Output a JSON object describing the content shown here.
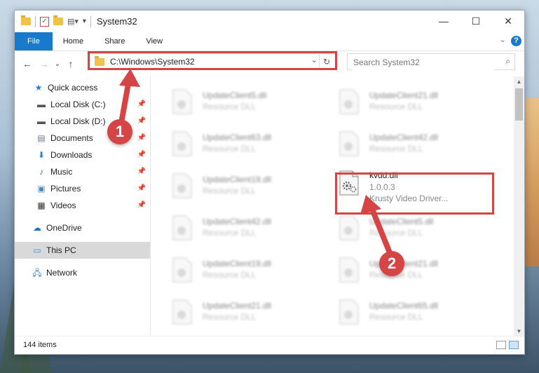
{
  "window": {
    "title": "System32",
    "minimize": "—",
    "maximize": "☐",
    "close": "✕"
  },
  "ribbon": {
    "tabs": [
      "File",
      "Home",
      "Share",
      "View"
    ],
    "help": "?",
    "collapse": "⌄"
  },
  "nav_buttons": {
    "back": "←",
    "forward": "→",
    "recent": "⌄",
    "up": "↑"
  },
  "address": {
    "path": "C:\\Windows\\System32",
    "dropdown": "⌄",
    "refresh": "↻"
  },
  "search": {
    "placeholder": "Search System32",
    "icon": "search-icon"
  },
  "sidebar": {
    "items": [
      {
        "label": "Quick access",
        "icon": "star-icon",
        "pinned": false
      },
      {
        "label": "Local Disk (C:)",
        "icon": "drive-icon",
        "pinned": true
      },
      {
        "label": "Local Disk (D:)",
        "icon": "drive-icon",
        "pinned": true
      },
      {
        "label": "Documents",
        "icon": "documents-icon",
        "pinned": true
      },
      {
        "label": "Downloads",
        "icon": "download-icon",
        "pinned": true
      },
      {
        "label": "Music",
        "icon": "music-icon",
        "pinned": true
      },
      {
        "label": "Pictures",
        "icon": "pictures-icon",
        "pinned": true
      },
      {
        "label": "Videos",
        "icon": "videos-icon",
        "pinned": true
      },
      {
        "label": "OneDrive",
        "icon": "cloud-icon",
        "pinned": false
      },
      {
        "label": "This PC",
        "icon": "pc-icon",
        "pinned": false,
        "selected": true
      },
      {
        "label": "Network",
        "icon": "network-icon",
        "pinned": false
      }
    ]
  },
  "files": {
    "left": [
      {
        "name": "UpdateClient5.dll",
        "sub": "Resource DLL"
      },
      {
        "name": "UpdateClient63.dll",
        "sub": "Resource DLL"
      },
      {
        "name": "UpdateClient19.dll",
        "sub": "Resource DLL"
      },
      {
        "name": "UpdateClient42.dll",
        "sub": "Resource DLL"
      },
      {
        "name": "UpdateClient19.dll",
        "sub": "Resource DLL"
      },
      {
        "name": "UpdateClient21.dll",
        "sub": "Resource DLL"
      }
    ],
    "right": [
      {
        "name": "UpdateClient21.dll",
        "sub": "Resource DLL"
      },
      {
        "name": "UpdateClient42.dll",
        "sub": "Resource DLL"
      },
      {
        "name": "kvdd.dll",
        "sub": "1.0.0.3",
        "sub2": "Krusty Video Driver...",
        "highlighted": true
      },
      {
        "name": "UpdateClient5.dll",
        "sub": "Resource DLL"
      },
      {
        "name": "UpdateClient21.dll",
        "sub": "Resource DLL"
      },
      {
        "name": "UpdateClient65.dll",
        "sub": "Resource DLL"
      }
    ]
  },
  "status": {
    "items": "144 items"
  },
  "annotations": {
    "step1": "1",
    "step2": "2",
    "accent": "#d64545"
  }
}
